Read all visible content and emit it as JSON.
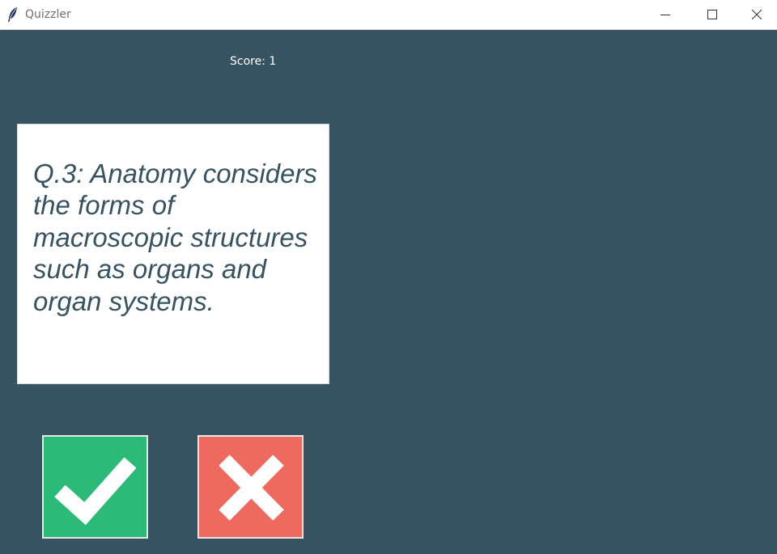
{
  "window": {
    "title": "Quizzler",
    "app_icon": "feather-icon",
    "controls": [
      "minimize-icon",
      "maximize-icon",
      "close-icon"
    ]
  },
  "score": {
    "label": "Score: 1"
  },
  "question": {
    "text": "Q.3: Anatomy considers the forms of macroscopic structures such as organs and organ systems."
  },
  "buttons": {
    "true": {
      "icon": "checkmark-icon",
      "color": "#2bba78"
    },
    "false": {
      "icon": "cross-icon",
      "color": "#ef6a5e"
    }
  },
  "colors": {
    "background": "#375362",
    "card": "#ffffff",
    "question_text": "#375362"
  }
}
